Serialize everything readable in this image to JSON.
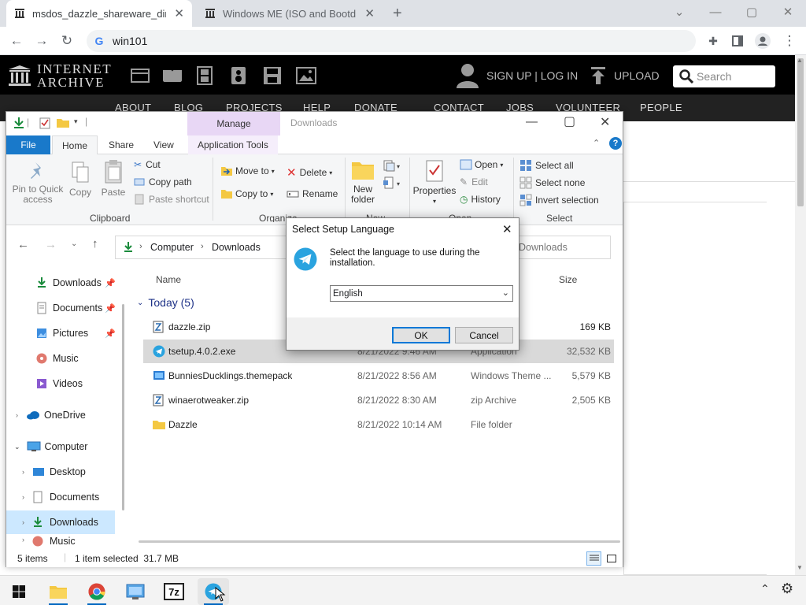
{
  "chrome": {
    "tabs": [
      {
        "title": "msdos_dazzle_shareware_directo"
      },
      {
        "title": "Windows ME (ISO and Bootdisk)"
      }
    ],
    "new_tab": "+",
    "address": "win101",
    "window": {
      "min": "—",
      "max": "▢",
      "close": "✕",
      "chev": "⌄"
    }
  },
  "ia": {
    "logo_line1": "INTERNET",
    "logo_line2": "ARCHIVE",
    "signup": "SIGN UP | LOG IN",
    "upload": "UPLOAD",
    "search_placeholder": "Search",
    "nav": [
      "ABOUT",
      "BLOG",
      "PROJECTS",
      "HELP",
      "DONATE",
      "CONTACT",
      "JOBS",
      "VOLUNTEER",
      "PEOPLE"
    ]
  },
  "explorer": {
    "title": "Downloads",
    "manage": "Manage",
    "tabs": [
      "File",
      "Home",
      "Share",
      "View",
      "Application Tools"
    ],
    "clipboard": {
      "pin": "Pin to Quick access",
      "copy": "Copy",
      "paste": "Paste",
      "cut": "Cut",
      "copy_path": "Copy path",
      "paste_shortcut": "Paste shortcut",
      "label": "Clipboard"
    },
    "organize": {
      "move_to": "Move to",
      "copy_to": "Copy to",
      "delete": "Delete",
      "rename": "Rename",
      "label": "Organize"
    },
    "new": {
      "new_folder": "New folder",
      "label": "New"
    },
    "open": {
      "properties": "Properties",
      "open": "Open",
      "edit": "Edit",
      "history": "History",
      "label": "Open"
    },
    "select": {
      "all": "Select all",
      "none": "Select none",
      "invert": "Invert selection",
      "label": "Select"
    },
    "breadcrumb": [
      "Computer",
      "Downloads"
    ],
    "search_placeholder": "Downloads",
    "nav": [
      {
        "label": "Downloads",
        "pinned": true
      },
      {
        "label": "Documents",
        "pinned": true
      },
      {
        "label": "Pictures",
        "pinned": true
      },
      {
        "label": "Music"
      },
      {
        "label": "Videos"
      },
      {
        "label": "OneDrive"
      },
      {
        "label": "Computer"
      },
      {
        "label": "Desktop"
      },
      {
        "label": "Documents"
      },
      {
        "label": "Downloads"
      },
      {
        "label": "Music"
      }
    ],
    "columns": {
      "name": "Name",
      "size": "Size"
    },
    "group": "Today (5)",
    "files": [
      {
        "name": "dazzle.zip",
        "date": "",
        "type": "",
        "size": "169 KB"
      },
      {
        "name": "tsetup.4.0.2.exe",
        "date": "8/21/2022 9:46 AM",
        "type": "Application",
        "size": "32,532 KB"
      },
      {
        "name": "BunniesDucklings.themepack",
        "date": "8/21/2022 8:56 AM",
        "type": "Windows Theme ...",
        "size": "5,579 KB"
      },
      {
        "name": "winaerotweaker.zip",
        "date": "8/21/2022 8:30 AM",
        "type": "zip Archive",
        "size": "2,505 KB"
      },
      {
        "name": "Dazzle",
        "date": "8/21/2022 10:14 AM",
        "type": "File folder",
        "size": ""
      }
    ],
    "status": {
      "items": "5 items",
      "selected": "1 item selected  31.7 MB"
    }
  },
  "dialog": {
    "title": "Select Setup Language",
    "message": "Select the language to use during the installation.",
    "language": "English",
    "ok": "OK",
    "cancel": "Cancel"
  }
}
